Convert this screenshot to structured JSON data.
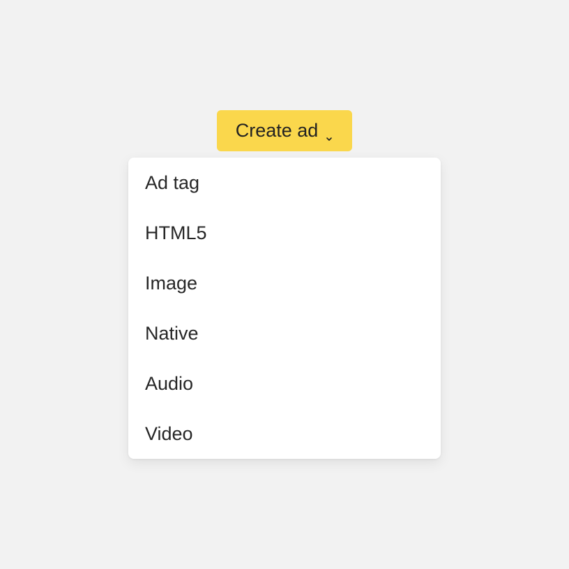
{
  "create_button": {
    "label": "Create ad",
    "icon": "chevron-down-icon",
    "color": "#fad74c"
  },
  "menu": {
    "items": [
      {
        "label": "Ad tag"
      },
      {
        "label": "HTML5"
      },
      {
        "label": "Image"
      },
      {
        "label": "Native"
      },
      {
        "label": "Audio"
      },
      {
        "label": "Video"
      }
    ]
  }
}
